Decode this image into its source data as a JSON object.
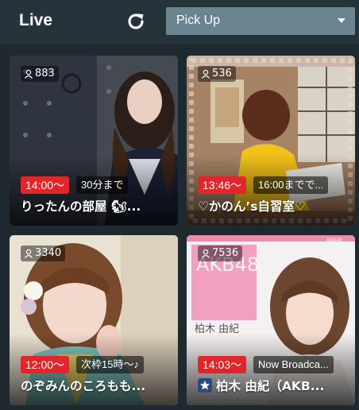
{
  "header": {
    "title": "Live",
    "filter_value": "Pick Up",
    "refresh_icon": "refresh-icon",
    "dropdown_icon": "caret-down-icon"
  },
  "cards": [
    {
      "viewers": "883",
      "start_time": "14:00〜",
      "note": "30分まで",
      "name": "りったんの部屋 🐿..."
    },
    {
      "viewers": "536",
      "start_time": "13:46〜",
      "note": "16:00までで...",
      "name": "♡かのん’s自習室♡"
    },
    {
      "viewers": "3340",
      "start_time": "12:00〜",
      "note": "次枠15時〜♪",
      "name": "のぞみんのころもも..."
    },
    {
      "viewers": "7536",
      "start_time": "14:03〜",
      "note": "Now Broadca...",
      "name": "柏木 由紀（AKB...",
      "thumb_text": "AKB48",
      "thumb_name": "柏木 由紀",
      "thumb_corner": "AKB48"
    }
  ],
  "colors": {
    "background": "#1f2a30",
    "header": "#25343b",
    "select": "#6b8590",
    "time_badge": "#e0262a"
  }
}
